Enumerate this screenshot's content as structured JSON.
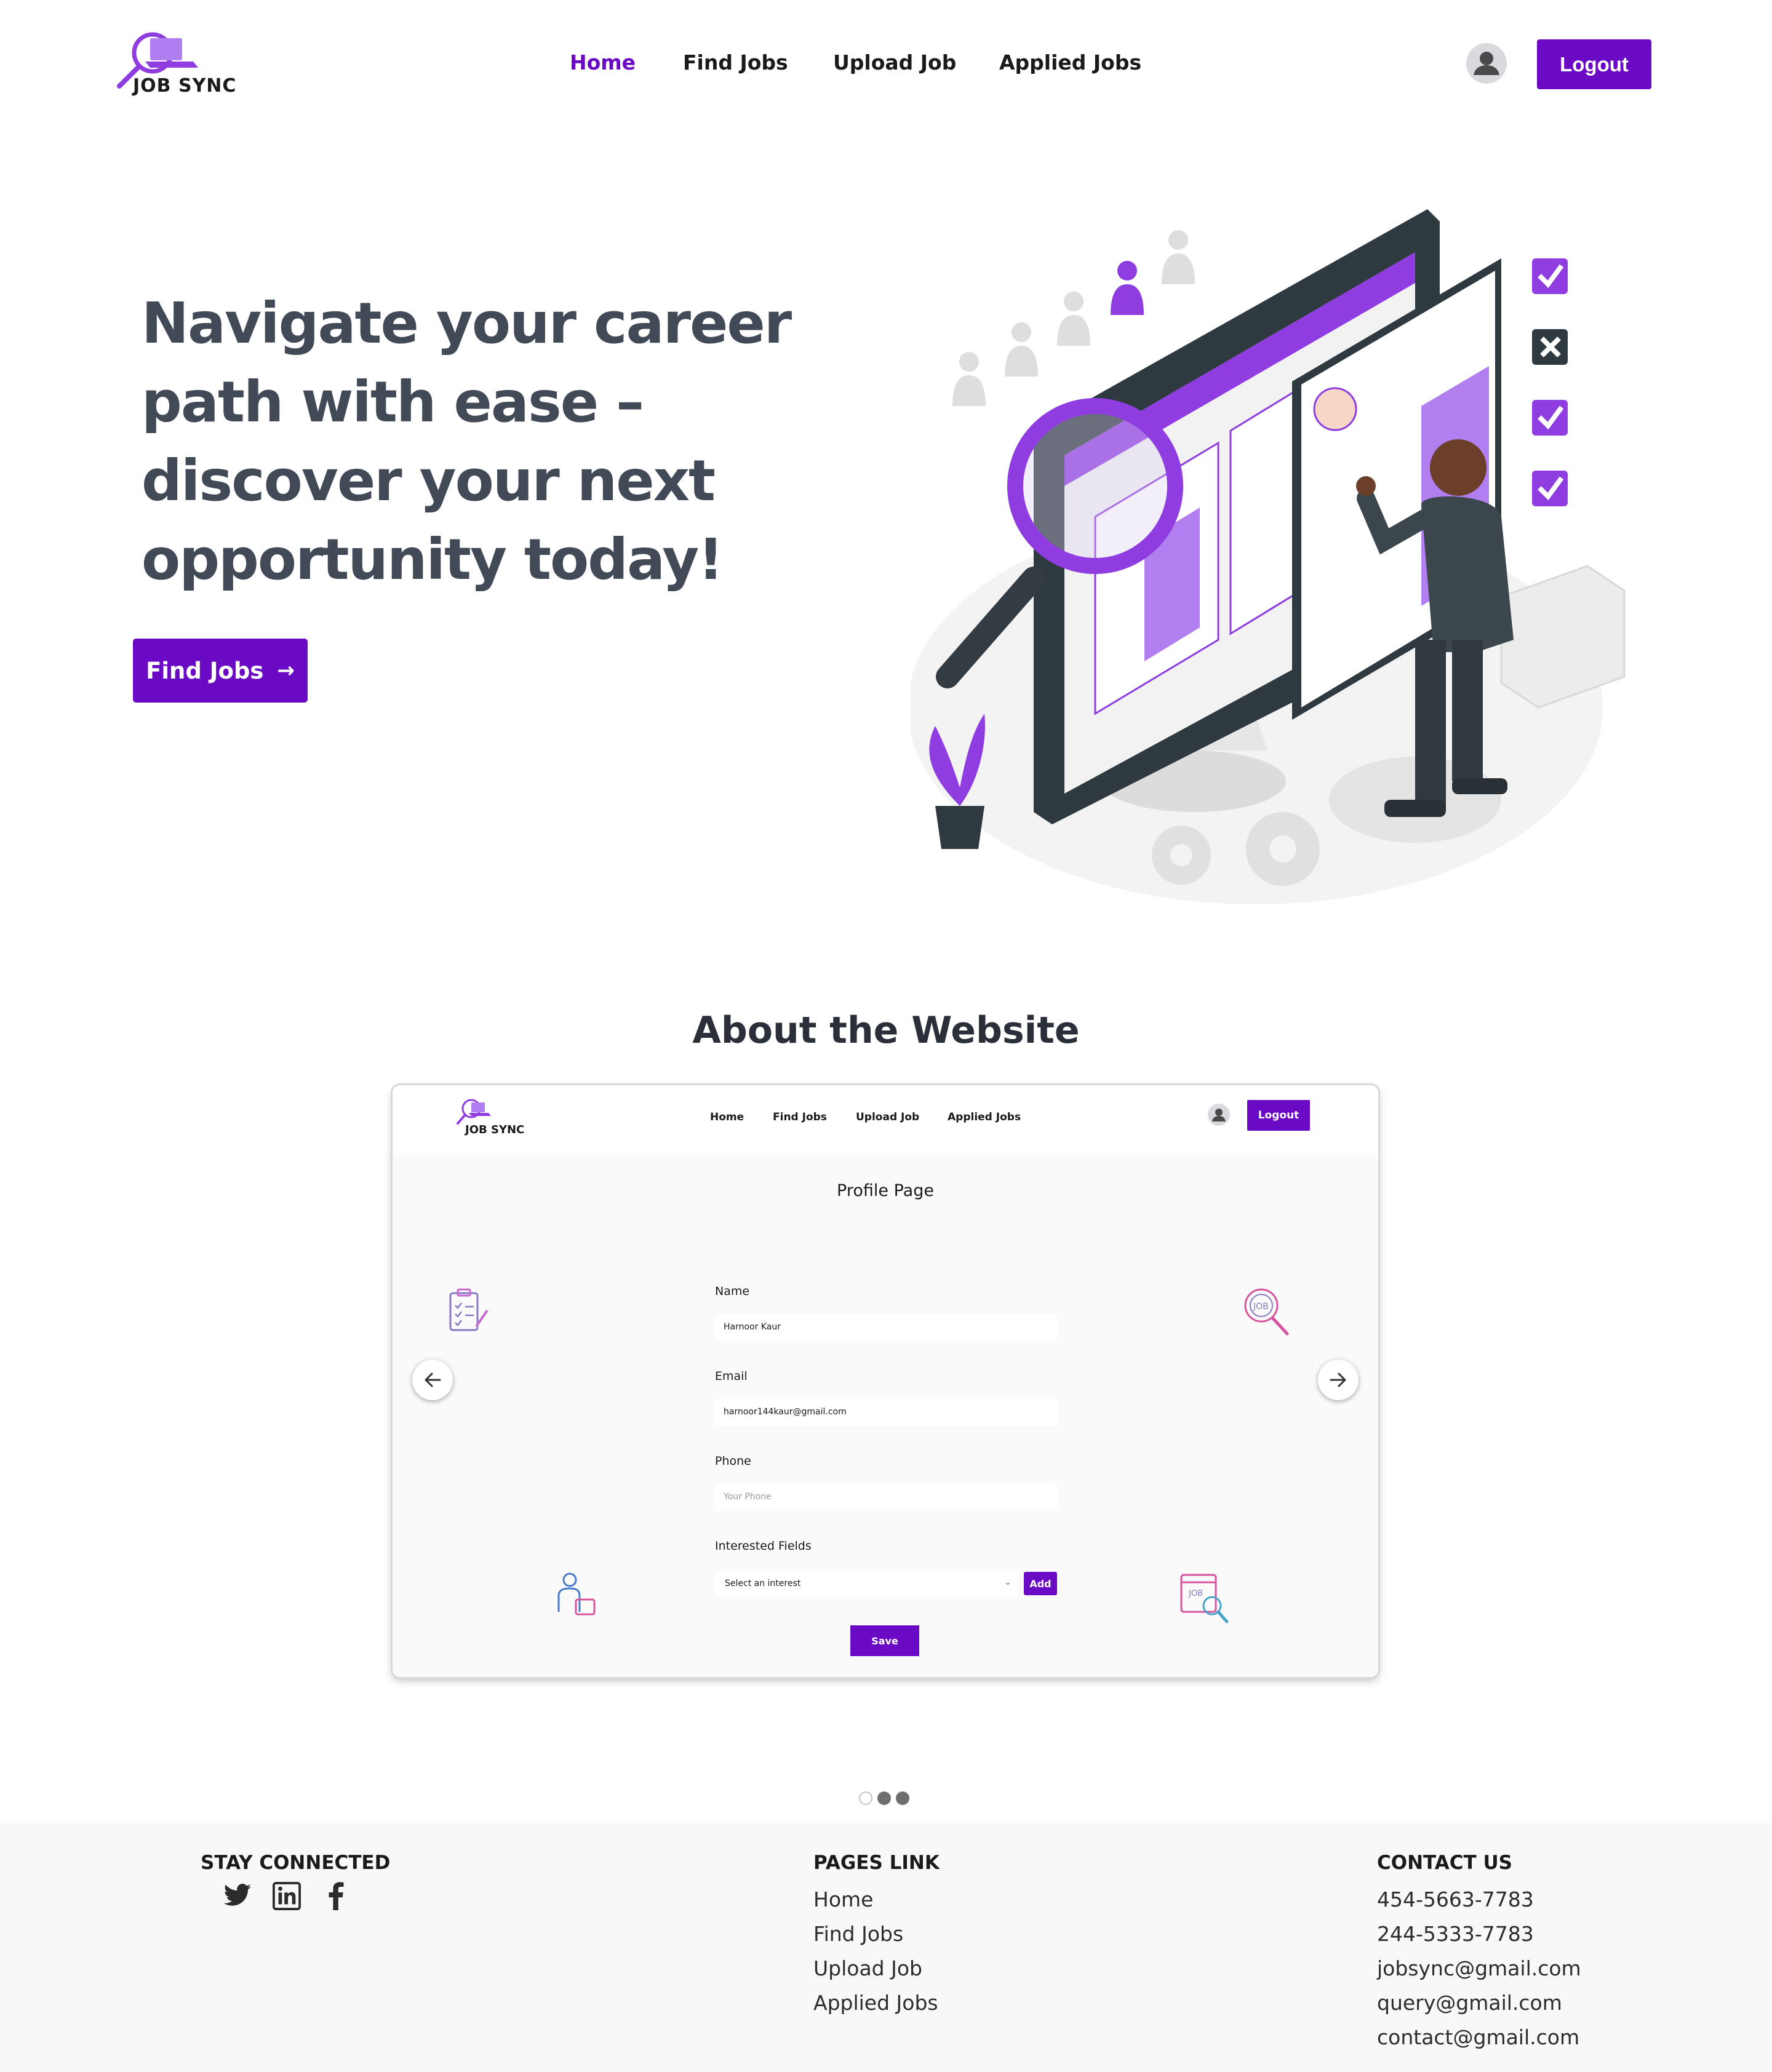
{
  "header": {
    "logo_text": "JOB SYNC",
    "nav": [
      "Home",
      "Find Jobs",
      "Upload Job",
      "Applied Jobs"
    ],
    "active_nav": "Home",
    "logout_label": "Logout"
  },
  "hero": {
    "title": "Navigate your career path with ease – discover your next opportunity today!",
    "cta_label": "Find Jobs"
  },
  "about": {
    "title": "About the Website",
    "slide": {
      "logo_text": "JOB SYNC",
      "nav": [
        "Home",
        "Find Jobs",
        "Upload Job",
        "Applied Jobs"
      ],
      "logout_label": "Logout",
      "page_title": "Profile Page",
      "fields": {
        "name_label": "Name",
        "name_value": "Harnoor Kaur",
        "email_label": "Email",
        "email_value": "harnoor144kaur@gmail.com",
        "phone_label": "Phone",
        "phone_placeholder": "Your Phone",
        "interests_label": "Interested Fields",
        "interests_placeholder": "Select an interest",
        "add_label": "Add",
        "save_label": "Save"
      }
    },
    "carousel": {
      "slide_count": 3,
      "active_index": 0
    }
  },
  "footer": {
    "stay_connected": "STAY CONNECTED",
    "social_icons": [
      "twitter-icon",
      "linkedin-icon",
      "facebook-icon"
    ],
    "pages_link": "PAGES LINK",
    "pages": [
      "Home",
      "Find Jobs",
      "Upload Job",
      "Applied Jobs"
    ],
    "contact_us": "CONTACT US",
    "contacts": [
      "454-5663-7783",
      "244-5333-7783",
      "jobsync@gmail.com",
      "query@gmail.com",
      "contact@gmail.com"
    ]
  },
  "colors": {
    "brand": "#6a0ac4",
    "heading": "#434a57",
    "footer_bg": "#f8f8f8"
  }
}
